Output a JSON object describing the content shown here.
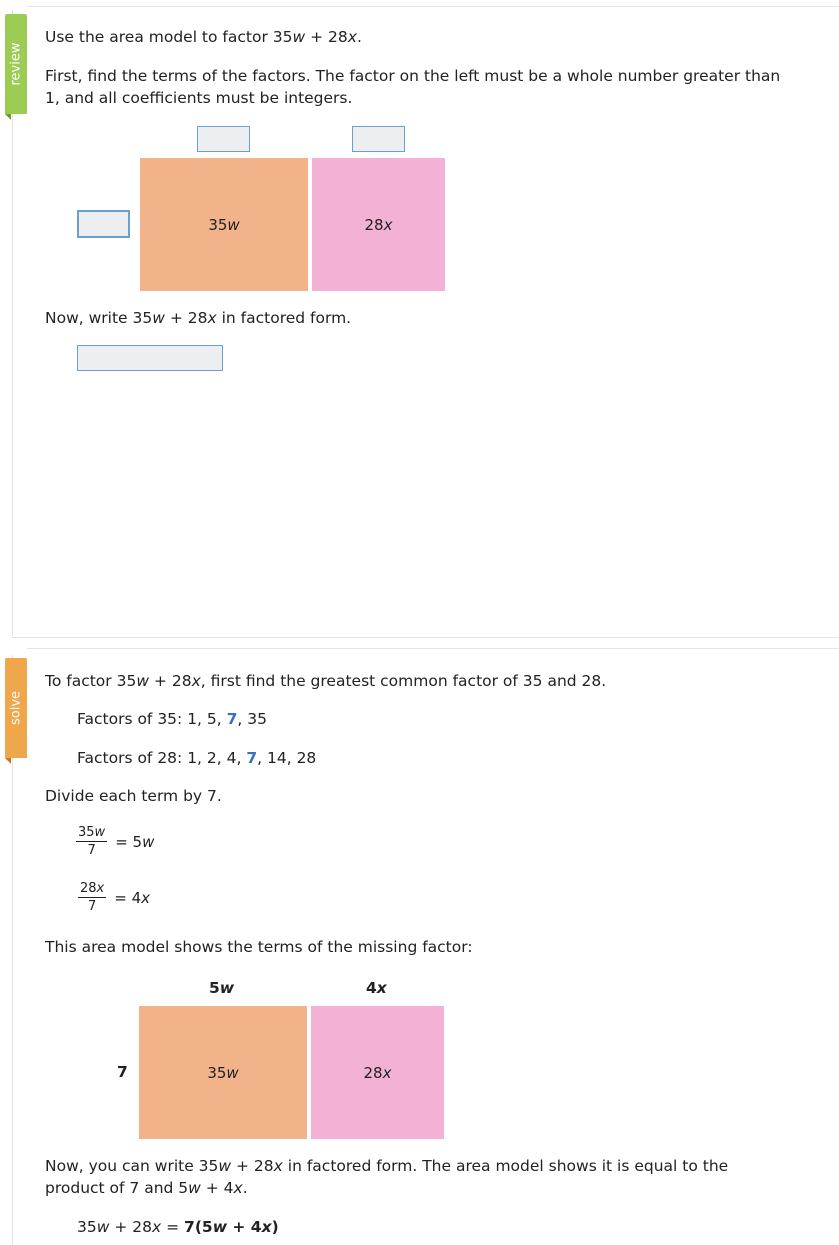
{
  "review": {
    "tab_label": "review",
    "prompt": {
      "pre": "Use the area model to factor 35",
      "var1": "w",
      "mid": " + 28",
      "var2": "x",
      "post": "."
    },
    "instruction": "First, find the terms of the factors. The factor on the left must be a whole number greater than 1, and all coefficients must be integers.",
    "area_model": {
      "left_block": {
        "coef": "35",
        "var": "w"
      },
      "right_block": {
        "coef": "28",
        "var": "x"
      }
    },
    "write_prompt": {
      "pre": "Now, write 35",
      "var1": "w",
      "mid": " + 28",
      "var2": "x",
      "post": " in factored form."
    }
  },
  "solve": {
    "tab_label": "solve",
    "intro": {
      "pre": "To factor 35",
      "var1": "w",
      "mid": " + 28",
      "var2": "x",
      "post": ", first find the greatest common factor of 35 and 28."
    },
    "factors_35": {
      "label": "Factors of 35: 1, 5, ",
      "gcf": "7",
      "rest": ", 35"
    },
    "factors_28": {
      "label": "Factors of 28: 1, 2, 4, ",
      "gcf": "7",
      "rest": ", 14, 28"
    },
    "divide": "Divide each term by 7.",
    "fractions": [
      {
        "num_coef": "35",
        "num_var": "w",
        "den": "7",
        "eq": "= 5",
        "eq_var": "w"
      },
      {
        "num_coef": "28",
        "num_var": "x",
        "den": "7",
        "eq": "= 4",
        "eq_var": "x"
      }
    ],
    "area_intro": "This area model shows the terms of the missing factor:",
    "area_model": {
      "top_left": {
        "coef": "5",
        "var": "w"
      },
      "top_right": {
        "coef": "4",
        "var": "x"
      },
      "side": "7",
      "left_block": {
        "coef": "35",
        "var": "w"
      },
      "right_block": {
        "coef": "28",
        "var": "x"
      }
    },
    "conclusion": {
      "line1_pre": "Now, you can write 35",
      "line1_var1": "w",
      "line1_mid": " + 28",
      "line1_var2": "x",
      "line1_post": " in factored form. The area model shows it is equal to the",
      "line2_pre": "product of 7 and 5",
      "line2_var1": "w",
      "line2_mid": " + 4",
      "line2_var2": "x",
      "line2_post": "."
    },
    "final": {
      "lhs_pre": "35",
      "lhs_var1": "w",
      "lhs_mid": " + 28",
      "lhs_var2": "x",
      "lhs_eq": " = ",
      "rhs_pre": "7(5",
      "rhs_var1": "w",
      "rhs_mid": " + 4",
      "rhs_var2": "x",
      "rhs_post": ")"
    }
  },
  "colors": {
    "review_tab": "#9ccc54",
    "solve_tab": "#f0a64a",
    "orange_block": "#f2b38a",
    "pink_block": "#f3b1d5",
    "highlight": "#3b6fc4",
    "input_border": "#6a9fd1"
  }
}
